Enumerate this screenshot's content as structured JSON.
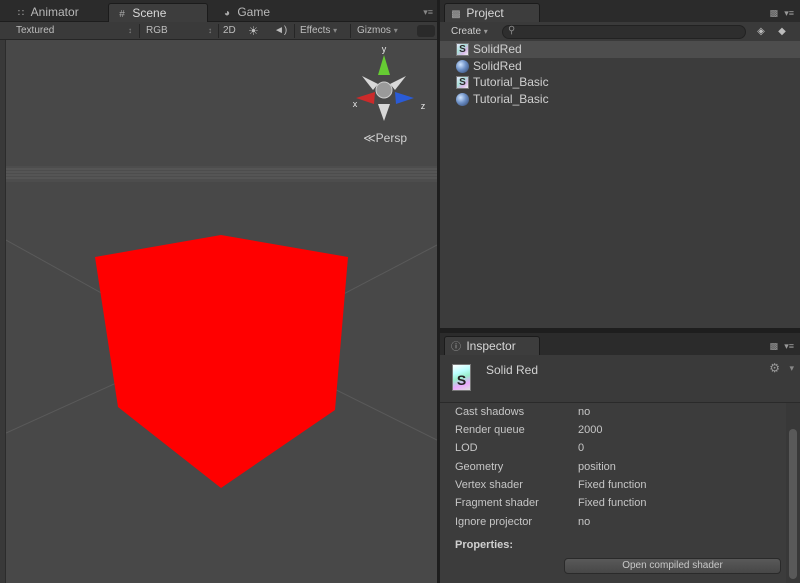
{
  "scene_window": {
    "tabs": [
      {
        "label": "Animator",
        "icon": "animator-icon"
      },
      {
        "label": "Scene",
        "icon": "scene-grid-icon"
      },
      {
        "label": "Game",
        "icon": "game-pacman-icon"
      }
    ],
    "toolbar": {
      "render_mode": "Textured",
      "color_mode": "RGB",
      "mode_2d": "2D",
      "effects": "Effects",
      "gizmos": "Gizmos"
    },
    "gizmo": {
      "x": "x",
      "y": "y",
      "z": "z",
      "projection": "Persp"
    },
    "cube_color": "#ff0000"
  },
  "project_panel": {
    "tab_label": "Project",
    "create_label": "Create",
    "search_placeholder": "",
    "assets": [
      {
        "name": "SolidRed",
        "type": "shader"
      },
      {
        "name": "SolidRed",
        "type": "material"
      },
      {
        "name": "Tutorial_Basic",
        "type": "shader"
      },
      {
        "name": "Tutorial_Basic",
        "type": "material"
      }
    ],
    "selected_index": 0
  },
  "inspector": {
    "tab_label": "Inspector",
    "title": "Solid Red",
    "icon_letter": "S",
    "properties": [
      {
        "key": "Cast shadows",
        "value": "no"
      },
      {
        "key": "Render queue",
        "value": "2000"
      },
      {
        "key": "LOD",
        "value": "0"
      },
      {
        "key": "Geometry",
        "value": "position"
      },
      {
        "key": "Vertex shader",
        "value": "Fixed function"
      },
      {
        "key": "Fragment shader",
        "value": "Fixed function"
      },
      {
        "key": "Ignore projector",
        "value": "no"
      }
    ],
    "properties_label": "Properties:",
    "open_button": "Open compiled shader"
  }
}
